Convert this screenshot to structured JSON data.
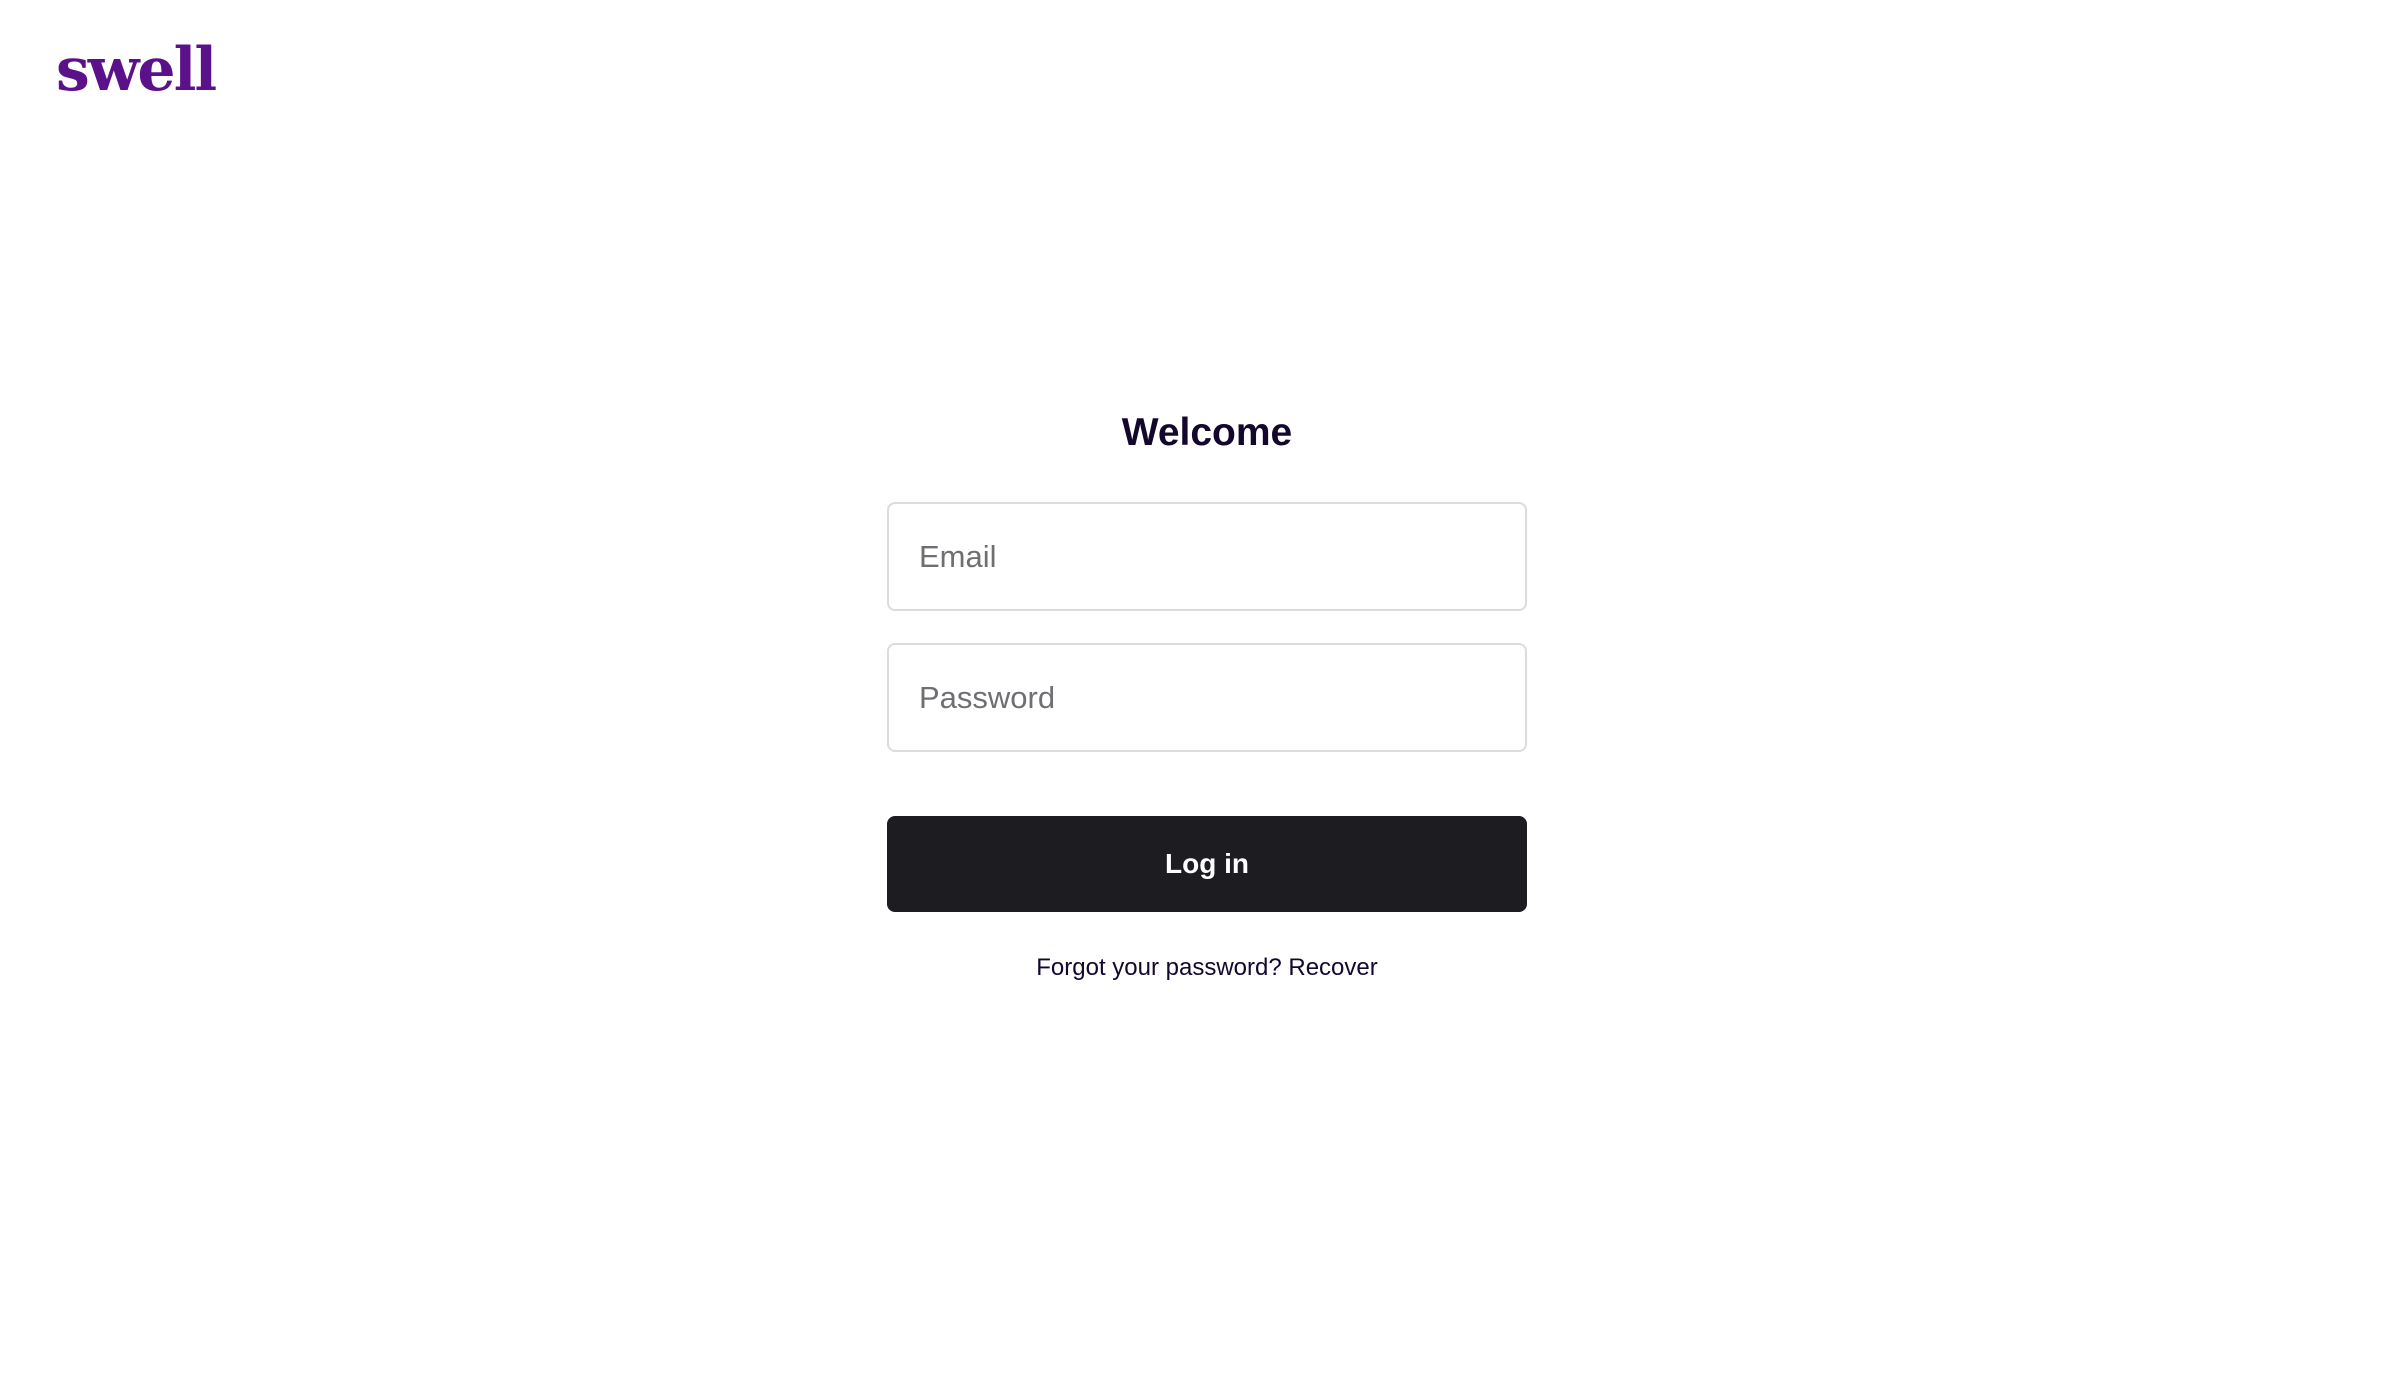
{
  "brand": {
    "logo_text": "swell",
    "color": "#5b1189"
  },
  "login": {
    "title": "Welcome",
    "email_placeholder": "Email",
    "password_placeholder": "Password",
    "submit_label": "Log in",
    "forgot_text": "Forgot your password?",
    "recover_label": "Recover"
  },
  "colors": {
    "button_bg": "#1d1c21",
    "title_text": "#13072e",
    "input_border": "#dcdce0"
  }
}
